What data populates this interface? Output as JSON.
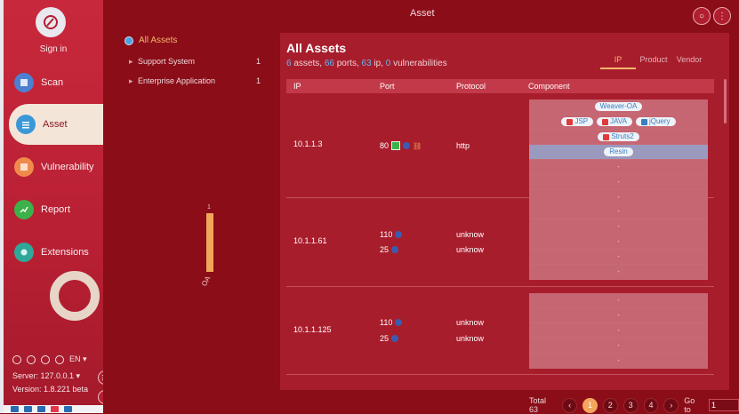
{
  "sidebar": {
    "sign_in": "Sign in",
    "nav": [
      {
        "label": "Scan"
      },
      {
        "label": "Asset"
      },
      {
        "label": "Vulnerability"
      },
      {
        "label": "Report"
      },
      {
        "label": "Extensions"
      }
    ],
    "lang": "EN",
    "server": "Server: 127.0.0.1",
    "version": "Version: 1.8.221 beta"
  },
  "header": {
    "title": "Asset"
  },
  "tree": {
    "root": "All Assets",
    "items": [
      {
        "label": "Support System",
        "count": "1"
      },
      {
        "label": "Enterprise Application",
        "count": "1"
      }
    ],
    "chart": {
      "bar_value": "1",
      "bar_label": "OA"
    }
  },
  "chart_data": {
    "type": "bar",
    "categories": [
      "OA"
    ],
    "values": [
      1
    ]
  },
  "main": {
    "title": "All Assets",
    "summary": {
      "assets": "6",
      "assets_label": " assets, ",
      "ports": "66",
      "ports_label": " ports, ",
      "ip": "63",
      "ip_label": " ip, ",
      "vulns": "0",
      "vulns_label": " vulnerabilities"
    },
    "tabs": [
      "IP",
      "Product",
      "Vendor"
    ],
    "columns": [
      "IP",
      "Port",
      "Protocol",
      "Component"
    ],
    "rows": [
      {
        "ip": "10.1.1.3",
        "ports": [
          {
            "port": "80",
            "protocol": "http"
          }
        ],
        "components": [
          "Weaver-OA",
          "JSP",
          "JAVA",
          "jQuery",
          "Struts2",
          "Resin"
        ],
        "dashes": [
          "-",
          "-",
          "-"
        ]
      },
      {
        "ip": "10.1.1.61",
        "ports": [
          {
            "port": "110",
            "protocol": "unknow"
          },
          {
            "port": "25",
            "protocol": "unknow"
          }
        ],
        "dashes": [
          "-",
          "-",
          "-",
          "-",
          "-"
        ]
      },
      {
        "ip": "10.1.1.125",
        "ports": [
          {
            "port": "110",
            "protocol": "unknow"
          },
          {
            "port": "25",
            "protocol": "unknow"
          }
        ],
        "dashes": [
          "-",
          "-",
          "-",
          "-",
          "-"
        ]
      }
    ]
  },
  "pagination": {
    "total": "Total 63",
    "pages": [
      "1",
      "2",
      "3",
      "4"
    ],
    "goto_label": "Go to",
    "goto_value": "1"
  },
  "colors": {
    "accent": "#f5a65d",
    "link": "#62b6f2",
    "background": "#8a0d18"
  }
}
